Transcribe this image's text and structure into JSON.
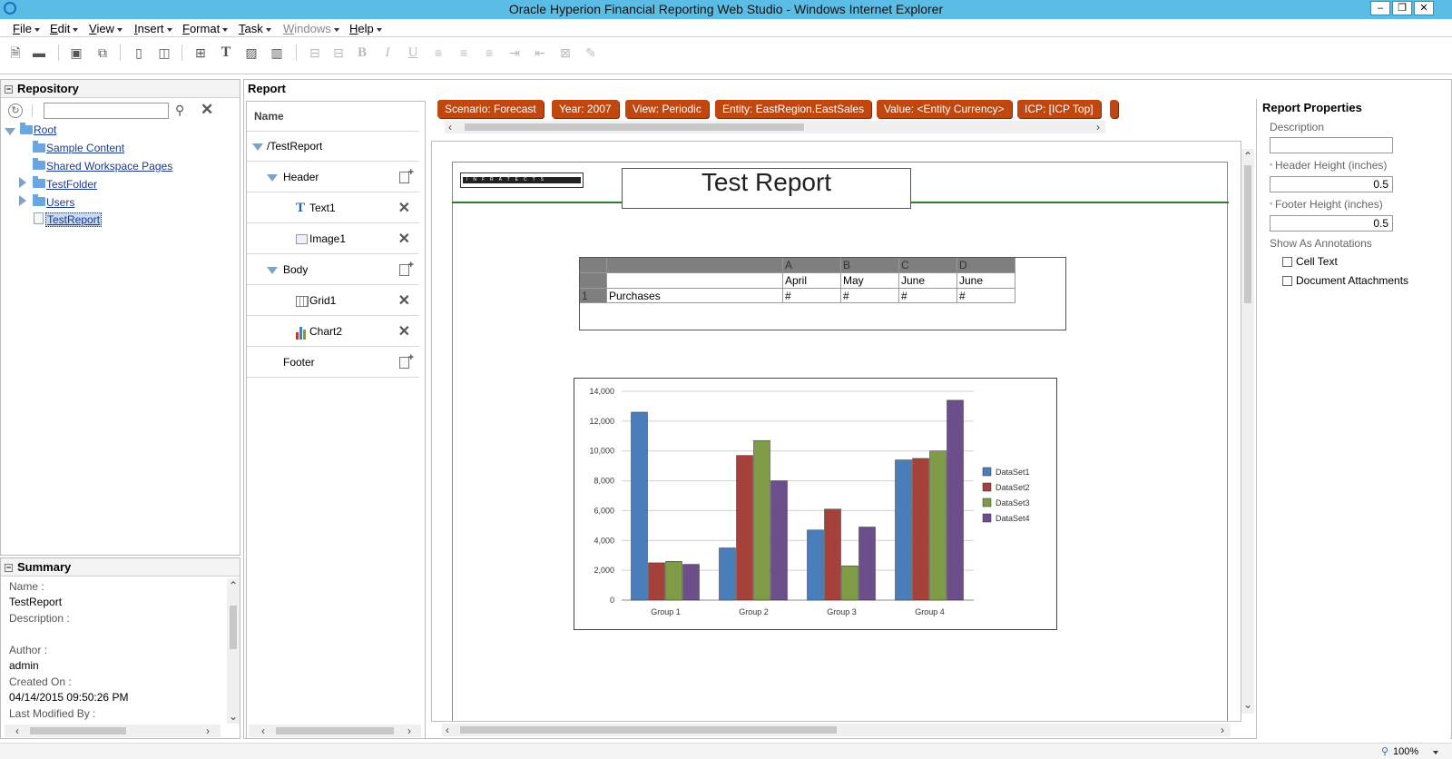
{
  "window": {
    "title": "Oracle Hyperion Financial Reporting Web Studio - Windows Internet Explorer",
    "controls": [
      "minimize-button",
      "restore-button",
      "close-button"
    ]
  },
  "menu": {
    "items": [
      {
        "key": "F",
        "rest": "ile"
      },
      {
        "key": "E",
        "rest": "dit"
      },
      {
        "key": "V",
        "rest": "iew"
      },
      {
        "key": "I",
        "rest": "nsert"
      },
      {
        "key": "F",
        "rest": "ormat"
      },
      {
        "key": "T",
        "rest": "ask"
      },
      {
        "key": "W",
        "rest": "indows"
      },
      {
        "key": "H",
        "rest": "elp"
      }
    ]
  },
  "toolbar": {
    "bold_glyph": "B",
    "italic_glyph": "I",
    "underline_glyph": "U",
    "text_glyph": "T"
  },
  "repository": {
    "title": "Repository",
    "search_placeholder": "",
    "tree": [
      {
        "label": "Root"
      },
      {
        "label": "Sample Content"
      },
      {
        "label": "Shared Workspace Pages"
      },
      {
        "label": "TestFolder"
      },
      {
        "label": "Users"
      },
      {
        "label": "TestReport"
      }
    ]
  },
  "summary": {
    "title": "Summary",
    "name_label": "Name :",
    "name_value": "TestReport",
    "description_label": "Description :",
    "description_value": "",
    "author_label": "Author :",
    "author_value": "admin",
    "created_label": "Created On :",
    "created_value": "04/14/2015 09:50:26 PM",
    "modified_label": "Last Modified By :"
  },
  "report": {
    "title": "Report",
    "name_header": "Name",
    "outline": [
      {
        "label": "/TestReport"
      },
      {
        "label": "Header"
      },
      {
        "label": "Text1"
      },
      {
        "label": "Image1"
      },
      {
        "label": "Body"
      },
      {
        "label": "Grid1"
      },
      {
        "label": "Chart2"
      },
      {
        "label": "Footer"
      }
    ],
    "pov": [
      "Scenario: Forecast",
      "Year: 2007",
      "View: Periodic",
      "Entity: EastRegion.EastSales",
      "Value: <Entity Currency>",
      "ICP: [ICP Top]"
    ],
    "logo_text": "INFRATECTS",
    "report_heading": "Test Report",
    "grid": {
      "col_letters": [
        "A",
        "B",
        "C",
        "D"
      ],
      "col_headers": [
        "April",
        "May",
        "June",
        "June"
      ],
      "row_number": "1",
      "row_label": "Purchases",
      "cells": [
        "#",
        "#",
        "#",
        "#"
      ]
    }
  },
  "chart_data": {
    "type": "bar",
    "categories": [
      "Group 1",
      "Group 2",
      "Group 3",
      "Group 4"
    ],
    "series": [
      {
        "name": "DataSet1",
        "color": "#4a7ebb",
        "values": [
          12600,
          3500,
          4700,
          9400
        ]
      },
      {
        "name": "DataSet2",
        "color": "#a5413a",
        "values": [
          2500,
          9700,
          6100,
          9500
        ]
      },
      {
        "name": "DataSet3",
        "color": "#7f9b45",
        "values": [
          2600,
          10700,
          2300,
          10000
        ]
      },
      {
        "name": "DataSet4",
        "color": "#6b4e8a",
        "values": [
          2400,
          8000,
          4900,
          13400
        ]
      }
    ],
    "ylim": [
      0,
      14000
    ],
    "yticks": [
      "0",
      "2,000",
      "4,000",
      "6,000",
      "8,000",
      "10,000",
      "12,000",
      "14,000"
    ],
    "grid": true,
    "legend": "right"
  },
  "properties": {
    "title": "Report Properties",
    "description_label": "Description",
    "header_height_label": "Header Height (inches)",
    "header_height_value": "0.5",
    "footer_height_label": "Footer Height (inches)",
    "footer_height_value": "0.5",
    "annotations_label": "Show As Annotations",
    "cell_text_label": "Cell Text",
    "doc_attachments_label": "Document Attachments"
  },
  "statusbar": {
    "zoom": "100%"
  }
}
